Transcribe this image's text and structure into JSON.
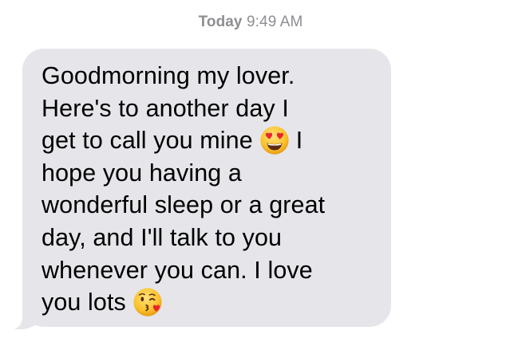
{
  "header": {
    "timestamp_day": "Today",
    "timestamp_time": "9:49 AM"
  },
  "message": {
    "direction": "incoming",
    "bubble_color": "#e5e5ea",
    "text_color": "#000000",
    "lines": [
      "Goodmorning my lover.",
      "Here's to another day I",
      "get to call you mine",
      "I",
      "hope you having a",
      "wonderful sleep or a great",
      "day, and I'll talk to you",
      "whenever you can. I love",
      "you lots"
    ],
    "emojis": {
      "first": "heart-eyes-emoji",
      "second": "kissing-heart-emoji"
    }
  }
}
